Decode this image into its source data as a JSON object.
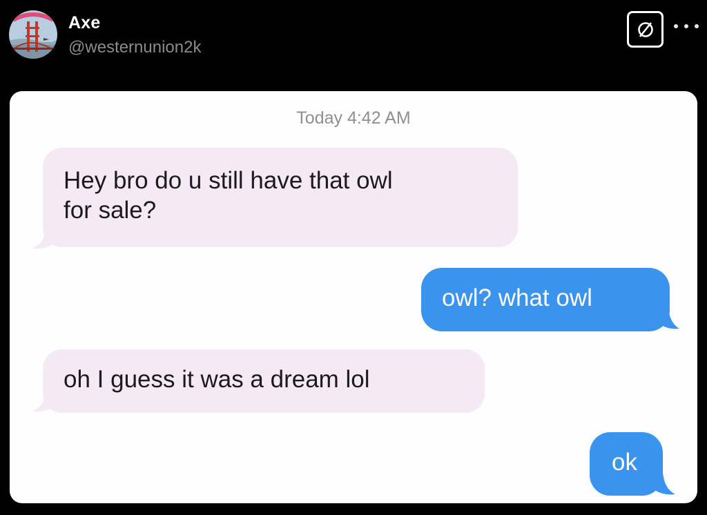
{
  "author": {
    "display_name": "Axe",
    "handle": "@westernunion2k",
    "avatar_icon": "bridge-avatar-icon"
  },
  "header_actions": {
    "badge_icon": "empty-set-badge-icon",
    "more_icon": "ellipsis-icon"
  },
  "conversation": {
    "timestamp": "Today 4:42 AM",
    "messages": [
      {
        "direction": "incoming",
        "lines": [
          "Hey bro do u still have that owl",
          "for sale?"
        ]
      },
      {
        "direction": "outgoing",
        "lines": [
          "owl? what owl"
        ]
      },
      {
        "direction": "incoming",
        "lines": [
          "oh I guess it was a dream lol"
        ]
      },
      {
        "direction": "outgoing",
        "lines": [
          "ok"
        ]
      }
    ]
  },
  "colors": {
    "incoming_bubble": "#f5e9f6",
    "outgoing_bubble": "#3a93ec",
    "background": "#000000"
  }
}
